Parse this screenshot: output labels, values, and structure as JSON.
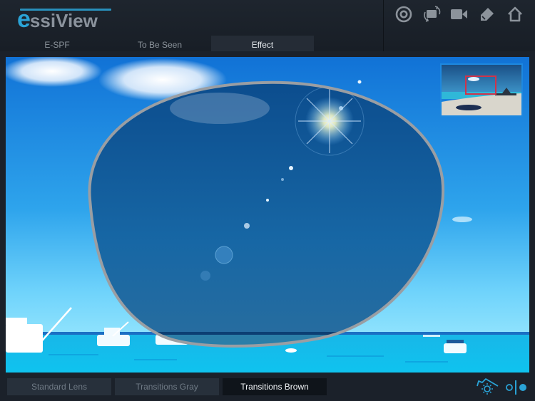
{
  "app": {
    "logo_accent": "e",
    "logo_rest": "ssiView",
    "brand_color": "#2aa3d6"
  },
  "toolbar": {
    "buttons": [
      {
        "name": "target-icon",
        "label": "Target"
      },
      {
        "name": "rotate-icon",
        "label": "Rotate"
      },
      {
        "name": "video-camera-icon",
        "label": "Video"
      },
      {
        "name": "tag-icon",
        "label": "Tag"
      },
      {
        "name": "home-icon",
        "label": "Home"
      }
    ]
  },
  "tabs": [
    {
      "label": "E-SPF",
      "active": false
    },
    {
      "label": "To Be Seen",
      "active": false
    },
    {
      "label": "Effect",
      "active": true
    }
  ],
  "preview": {
    "scene": "Beach and sea with boats, viewed through sunglass lens",
    "lens_rim_color": "#9a9ea3",
    "thumbnail_frame_color": "#d0334a"
  },
  "lens_options": [
    {
      "label": "Standard Lens",
      "active": false
    },
    {
      "label": "Transitions Gray",
      "active": false
    },
    {
      "label": "Transitions Brown",
      "active": true
    }
  ],
  "controls": {
    "uv_icon": "sun-under-roof-icon",
    "compare_icon": "split-compare-icon",
    "accent_color": "#2aa3d6"
  }
}
